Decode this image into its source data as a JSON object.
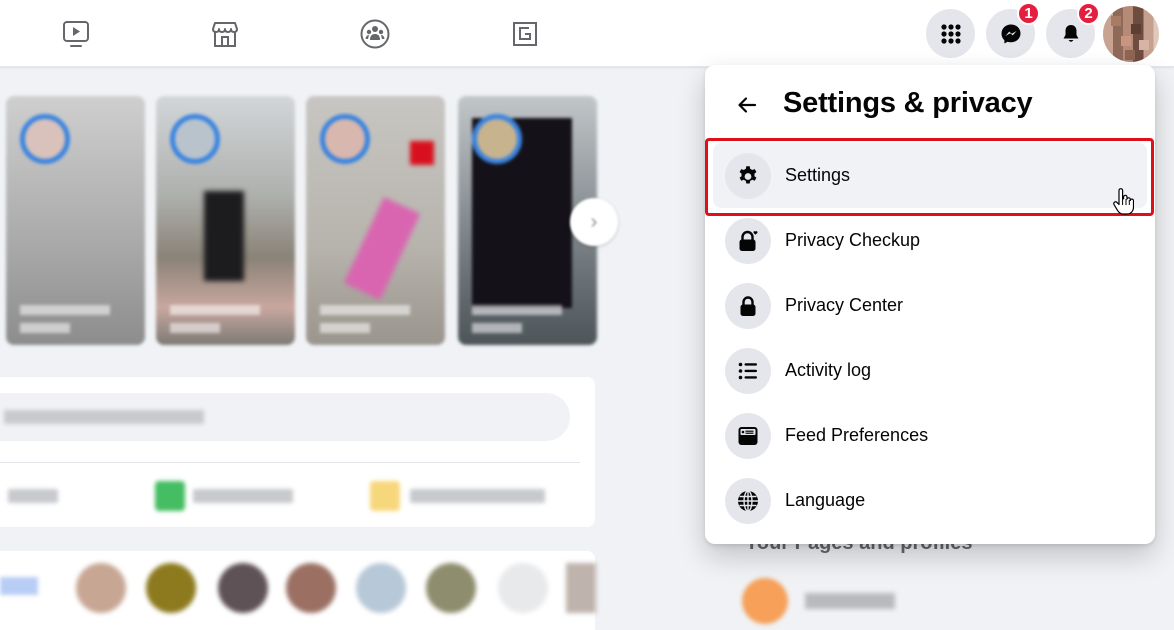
{
  "topbar": {
    "nav_tabs": [
      {
        "name": "watch",
        "icon": "video-play-icon"
      },
      {
        "name": "marketplace",
        "icon": "storefront-icon"
      },
      {
        "name": "groups",
        "icon": "groups-icon"
      },
      {
        "name": "gaming",
        "icon": "gaming-icon"
      }
    ],
    "menu_icon": "grid-menu-icon",
    "messenger": {
      "icon": "messenger-icon",
      "badge": "1"
    },
    "notifications": {
      "icon": "bell-icon",
      "badge": "2"
    },
    "account_avatar": "profile-avatar"
  },
  "settings_panel": {
    "back_icon": "arrow-left-icon",
    "title": "Settings & privacy",
    "items": [
      {
        "label": "Settings",
        "icon": "gear-icon",
        "highlighted": true
      },
      {
        "label": "Privacy Checkup",
        "icon": "lock-heart-icon"
      },
      {
        "label": "Privacy Center",
        "icon": "lock-icon"
      },
      {
        "label": "Activity log",
        "icon": "list-icon"
      },
      {
        "label": "Feed Preferences",
        "icon": "feed-icon"
      },
      {
        "label": "Language",
        "icon": "globe-icon"
      }
    ]
  },
  "background": {
    "right_column_heading": "Your Pages and profiles"
  },
  "colors": {
    "highlight_border": "#e0101a",
    "badge": "#e41e3f",
    "story_ring": "#3a84e0"
  }
}
